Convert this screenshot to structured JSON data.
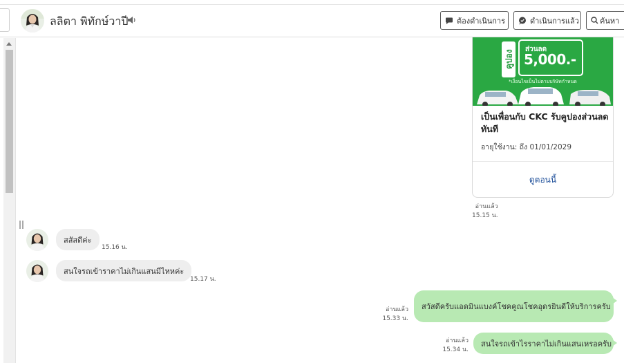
{
  "header": {
    "contact_name": "ลลิตา พิทักษ์วาปี",
    "buttons": {
      "todo": "ต้องดำเนินการ",
      "done": "ดำเนินการแล้ว",
      "search": "ค้นหา"
    }
  },
  "coupon_card": {
    "badge_vertical": "คูปอง",
    "discount_label": "ส่วนลด",
    "discount_amount": "5,000.-",
    "note": "*เงื่อนไขเป็นไปตามบริษัทกำหนด",
    "title": "เป็นเพื่อนกับ CKC รับคูปองส่วนลดทันที",
    "expiry": "อายุใช้งาน: ถึง 01/01/2029",
    "link_label": "ดูตอนนี้",
    "brand_color": "#2aa843"
  },
  "card_receipt": {
    "status": "อ่านแล้ว",
    "time": "15.15 น."
  },
  "messages": [
    {
      "direction": "in",
      "text": "สสัสดีค่ะ",
      "time": "15.16 น."
    },
    {
      "direction": "in",
      "text": "สนใจรถเข้าราคาไม่เกินแสนมีไหหค่ะ",
      "time": "15.17 น."
    },
    {
      "direction": "out",
      "text": "สวัสดีครับแอดมินแบงค์โชคคูณโชคอุดรยินดีให้บริการครับ",
      "status": "อ่านแล้ว",
      "time": "15.33 น."
    },
    {
      "direction": "out",
      "text": "สนใจรถเข้าไรราคาไม่เกินแสนเหรอครับ",
      "status": "อ่านแล้ว",
      "time": "15.34 น."
    }
  ],
  "colors": {
    "outgoing_bubble": "#b8e9b3",
    "incoming_bubble": "#eeeeee",
    "link": "#1d4e99"
  }
}
